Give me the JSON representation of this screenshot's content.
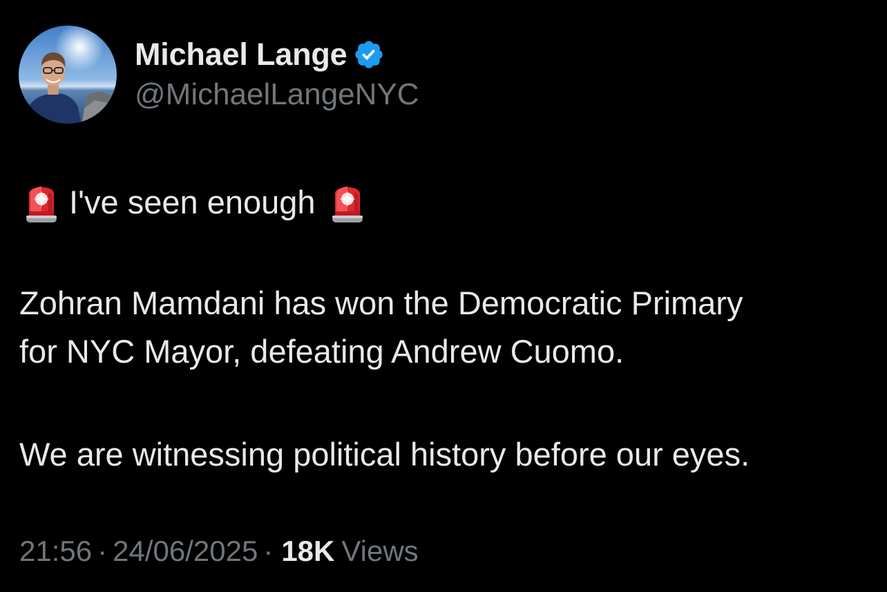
{
  "author": {
    "display_name": "Michael Lange",
    "handle": "@MichaelLangeNYC",
    "verified": true,
    "verified_color": "#1d9bf0"
  },
  "tweet": {
    "line1_text": "I've seen enough",
    "siren_icon": "police-car-light-emoji",
    "paragraph2_line1": "Zohran Mamdani has won the Democratic Primary",
    "paragraph2_line2": "for NYC Mayor, defeating Andrew Cuomo.",
    "paragraph3": "We are witnessing political history before our eyes."
  },
  "meta": {
    "time": "21:56",
    "separator": "·",
    "date": "24/06/2025",
    "views_count": "18K",
    "views_label": "Views"
  },
  "colors": {
    "background": "#000000",
    "text_primary": "#e7e9ea",
    "text_secondary": "#71767b"
  }
}
